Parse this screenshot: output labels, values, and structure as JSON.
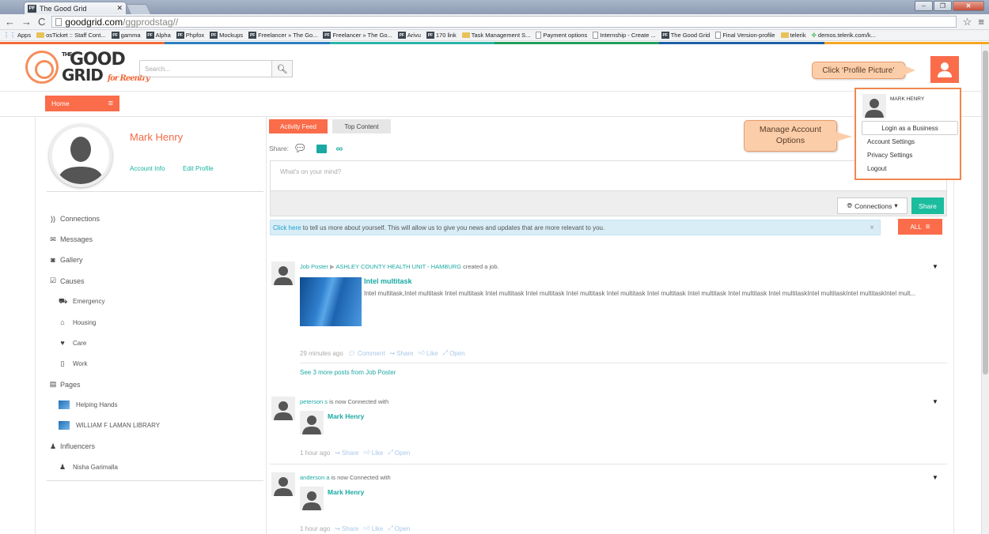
{
  "browser": {
    "tab_title": "The Good Grid",
    "url_host": "goodgrid.com",
    "url_path": "/ggprodstag//",
    "bookmarks": [
      {
        "label": "Apps",
        "icon": "apps"
      },
      {
        "label": "osTicket :: Staff Cont...",
        "icon": "folder"
      },
      {
        "label": "gamma",
        "icon": "pf"
      },
      {
        "label": "Alpha",
        "icon": "pf"
      },
      {
        "label": "Phpfox",
        "icon": "pf"
      },
      {
        "label": "Mockups",
        "icon": "pf"
      },
      {
        "label": "Freelancer » The Go...",
        "icon": "pf"
      },
      {
        "label": "Freelancer » The Go...",
        "icon": "pf"
      },
      {
        "label": "Arivu",
        "icon": "pf"
      },
      {
        "label": "170 link",
        "icon": "pf"
      },
      {
        "label": "Task Management S...",
        "icon": "folder"
      },
      {
        "label": "Payment options",
        "icon": "page"
      },
      {
        "label": "Internship - Create ...",
        "icon": "page"
      },
      {
        "label": "The Good Grid",
        "icon": "pf"
      },
      {
        "label": "Final Version-profile",
        "icon": "page"
      },
      {
        "label": "telerik",
        "icon": "folder"
      },
      {
        "label": "demos.telerik.com/k...",
        "icon": "telerik"
      }
    ]
  },
  "header": {
    "logo_the": "THE",
    "logo_good": "GOOD",
    "logo_grid": "GRID",
    "logo_tagline": "for Reentry",
    "search_placeholder": "Search...",
    "callout_profile": "Click ‘Profile Picture’",
    "callout_manage": "Manage Account Options"
  },
  "subnav": {
    "home_label": "Home"
  },
  "profile": {
    "name": "Mark Henry",
    "account_info": "Account Info",
    "edit_profile": "Edit Profile"
  },
  "menu": [
    {
      "label": "Connections",
      "icon": "rss-icon",
      "sub": false
    },
    {
      "label": "Messages",
      "icon": "envelope-icon",
      "sub": false
    },
    {
      "label": "Gallery",
      "icon": "camera-icon",
      "sub": false
    },
    {
      "label": "Causes",
      "icon": "checkbox-icon",
      "sub": false
    },
    {
      "label": "Emergency",
      "icon": "ambulance-icon",
      "sub": true
    },
    {
      "label": "Housing",
      "icon": "home-icon",
      "sub": true
    },
    {
      "label": "Care",
      "icon": "heart-icon",
      "sub": true
    },
    {
      "label": "Work",
      "icon": "building-icon",
      "sub": true
    },
    {
      "label": "Pages",
      "icon": "document-icon",
      "sub": false
    },
    {
      "label": "Helping Hands",
      "icon": "thumb",
      "sub": true
    },
    {
      "label": "WILLIAM F LAMAN LIBRARY",
      "icon": "thumb",
      "sub": true
    },
    {
      "label": "Influencers",
      "icon": "user-icon",
      "sub": false
    },
    {
      "label": "Nisha Garimalla",
      "icon": "user-icon",
      "sub": true
    }
  ],
  "feed": {
    "tab_activity": "Activity Feed",
    "tab_top": "Top Content",
    "share_label": "Share:",
    "post_placeholder": "What's on your mind?",
    "connections_btn": "Connections",
    "share_btn": "Share",
    "info_link": "Click here",
    "info_text": " to tell us more about yourself. This will allow us to give you news and updates that are more relevant to you.",
    "info_close": "×",
    "all_btn": "ALL",
    "posts": [
      {
        "author": "Job Poster",
        "target": "ASHLEY COUNTY HEALTH UNIT - HAMBURG",
        "action": " created a job.",
        "job_title": "Intel multitask",
        "job_desc": "Intel multitask,Intel multitask Intel multitask Intel multitask Intel multitask Intel multitask Intel multitask Intel multitask Intel multitask Intel multitask  Intel multitaskIntel multitaskIntel multitaskIntel mult...",
        "time": "29 minutes ago",
        "comment": "Comment",
        "share": "Share",
        "like": "Like",
        "open": "Open",
        "see_more": "See 3 more posts from Job Poster"
      },
      {
        "author": "peterson s",
        "action": " is now Connected with",
        "connected": "Mark Henry",
        "time": "1 hour ago",
        "share": "Share",
        "like": "Like",
        "open": "Open"
      },
      {
        "author": "anderson a",
        "action": " is now Connected with",
        "connected": "Mark Henry",
        "time": "1 hour ago",
        "share": "Share",
        "like": "Like",
        "open": "Open"
      }
    ]
  },
  "dropdown": {
    "name": "MARK HENRY",
    "login_business": "Login as a Business",
    "account_settings": "Account Settings",
    "privacy_settings": "Privacy Settings",
    "logout": "Logout"
  },
  "colors": {
    "accent": "#fa6c4a",
    "teal": "#1aa9a3",
    "share_green": "#1bbd9e",
    "callout": "#fbcea9"
  }
}
